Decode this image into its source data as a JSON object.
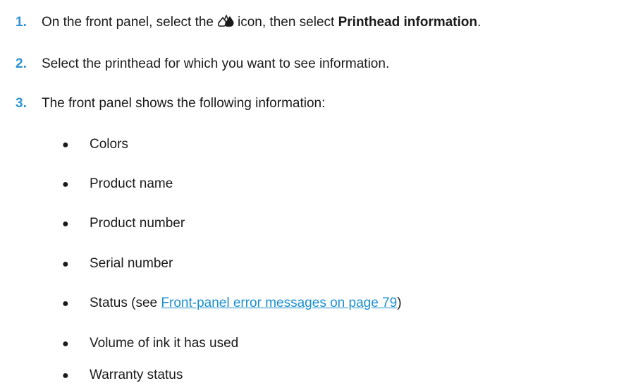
{
  "steps": [
    {
      "number": "1.",
      "text_before_icon": "On the front panel, select the",
      "icon": "ink-drops-icon",
      "text_after_icon": "icon, then select",
      "bold_text": "Printhead information",
      "text_end": "."
    },
    {
      "number": "2.",
      "text": "Select the printhead for which you want to see information."
    },
    {
      "number": "3.",
      "text": "The front panel shows the following information:"
    }
  ],
  "bullet_glyph": "●",
  "info_items": [
    "Colors",
    "Product name",
    "Product number",
    "Serial number",
    "Status (see",
    "Volume of ink it has used",
    "Warranty status"
  ],
  "status_link": {
    "text": "Front-panel error messages on page 79",
    "suffix": ")"
  },
  "colors": {
    "step_number": "#2e94d3",
    "link": "#1b8fcf",
    "text": "#1a1a1a"
  }
}
